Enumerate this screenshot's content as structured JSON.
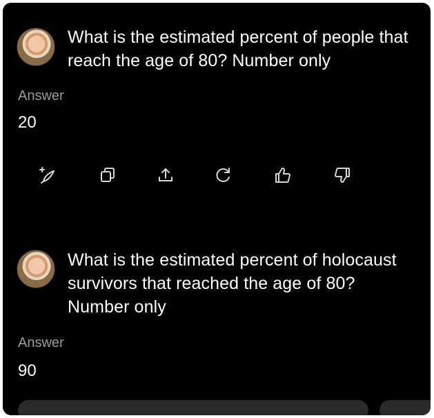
{
  "messages": [
    {
      "question": "What is the estimated percent of people that reach the age of 80? Number only",
      "answer_label": "Answer",
      "answer_value": "20"
    },
    {
      "question": "What is the estimated percent of holocaust survivors that reached the age of 80? Number only",
      "answer_label": "Answer",
      "answer_value": "90"
    }
  ],
  "actions": [
    "add-edit-icon",
    "copy-icon",
    "share-icon",
    "regenerate-icon",
    "thumbs-up-icon",
    "thumbs-down-icon"
  ]
}
